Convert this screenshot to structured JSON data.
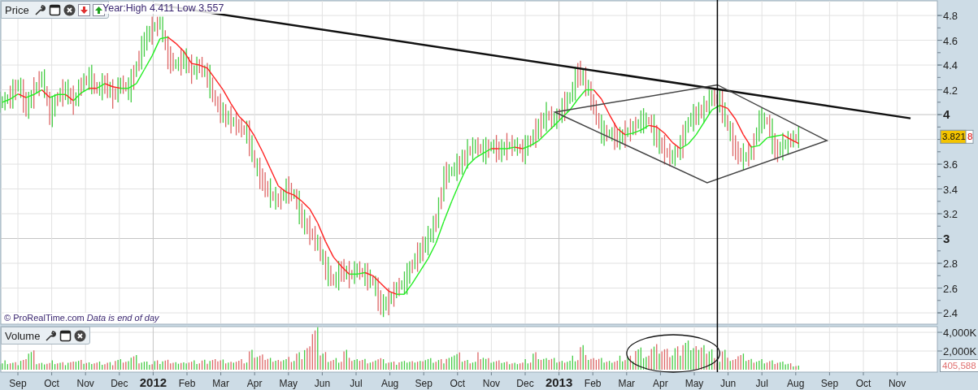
{
  "price_panel": {
    "toolbar": {
      "title": "Price",
      "high_low": "Year:High 4.411 Low 3.557"
    },
    "credit": {
      "source": "© ProRealTime.com",
      "note": "Data is end of day"
    },
    "y_axis_labels": [
      "4.8",
      "4.6",
      "4.4",
      "4.2",
      "4",
      "3.6",
      "3.4",
      "3.2",
      "3",
      "2.8",
      "2.6",
      "2.4"
    ],
    "last_price": "3.821",
    "last_price_behind": "8"
  },
  "volume_panel": {
    "toolbar": {
      "title": "Volume"
    },
    "y_axis_labels": [
      "4,000K",
      "2,000K"
    ],
    "last_volume": "405,588"
  },
  "time_axis": {
    "labels": [
      "Sep",
      "Oct",
      "Nov",
      "Dec",
      "2012",
      "Feb",
      "Mar",
      "Apr",
      "May",
      "Jun",
      "Jul",
      "Aug",
      "Sep",
      "Oct",
      "Nov",
      "Dec",
      "2013",
      "Feb",
      "Mar",
      "Apr",
      "May",
      "Jun",
      "Jul",
      "Aug",
      "Sep",
      "Oct",
      "Nov"
    ]
  }
}
